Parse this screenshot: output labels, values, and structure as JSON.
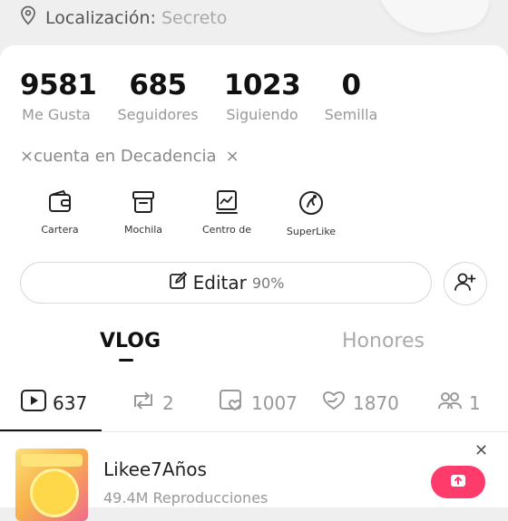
{
  "header": {
    "location_label": "Localización:",
    "location_value": "Secreto"
  },
  "stats": [
    {
      "number": "9581",
      "label": "Me Gusta"
    },
    {
      "number": "685",
      "label": "Seguidores"
    },
    {
      "number": "1023",
      "label": "Siguiendo"
    },
    {
      "number": "0",
      "label": "Semilla"
    }
  ],
  "signature": {
    "prefix": "×",
    "text": "cuenta en Decadencia",
    "suffix": "×"
  },
  "tools": [
    {
      "label": "Cartera",
      "icon": "wallet-icon"
    },
    {
      "label": "Mochila",
      "icon": "backpack-icon"
    },
    {
      "label": "Centro de",
      "icon": "chart-board-icon"
    },
    {
      "label": "SuperLike",
      "icon": "superlike-icon"
    }
  ],
  "edit": {
    "label": "Editar",
    "percent": "90%"
  },
  "tabs": [
    {
      "label": "VLOG",
      "active": true
    },
    {
      "label": "Honores",
      "active": false
    }
  ],
  "counters": [
    {
      "icon": "play-video-icon",
      "value": "637"
    },
    {
      "icon": "repost-icon",
      "value": "2"
    },
    {
      "icon": "liked-video-icon",
      "value": "1007"
    },
    {
      "icon": "heart-hand-icon",
      "value": "1870"
    },
    {
      "icon": "group-icon",
      "value": "1"
    }
  ],
  "video": {
    "title": "Likee7Años",
    "views": "49.4M Reproducciones"
  },
  "colors": {
    "accent": "#ff3b6b",
    "background": "#efefef",
    "card": "#ffffff",
    "muted_text": "#999999"
  }
}
